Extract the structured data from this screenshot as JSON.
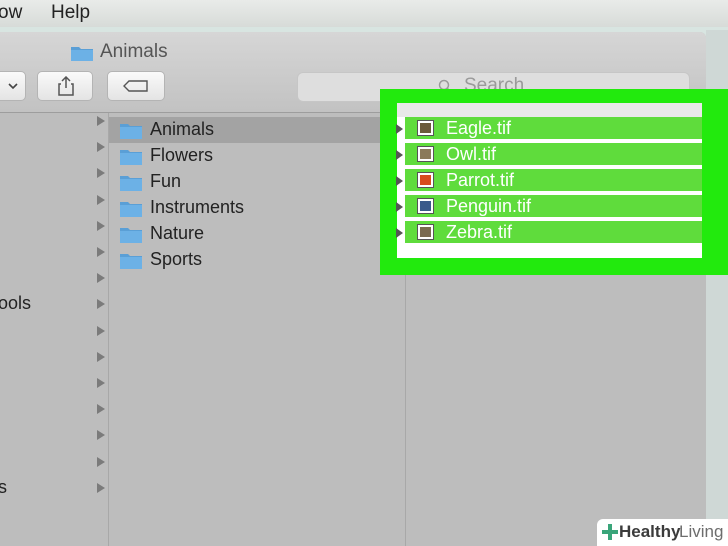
{
  "menu": {
    "item1": "ow",
    "item2": "Help"
  },
  "window": {
    "title": "Animals",
    "search_placeholder": "Search"
  },
  "sidebar": {
    "items": [
      {
        "label": ""
      },
      {
        "label": ""
      },
      {
        "label": ""
      },
      {
        "label": ""
      },
      {
        "label": ""
      },
      {
        "label": ""
      },
      {
        "label": ""
      },
      {
        "label": "ools"
      },
      {
        "label": ""
      },
      {
        "label": ""
      },
      {
        "label": ""
      },
      {
        "label": ""
      },
      {
        "label": ""
      },
      {
        "label": ""
      },
      {
        "label": "s"
      }
    ]
  },
  "folders": [
    {
      "label": "Animals",
      "selected": true
    },
    {
      "label": "Flowers",
      "selected": false
    },
    {
      "label": "Fun",
      "selected": false
    },
    {
      "label": "Instruments",
      "selected": false
    },
    {
      "label": "Nature",
      "selected": false
    },
    {
      "label": "Sports",
      "selected": false
    }
  ],
  "files": [
    {
      "label": "Eagle.tif",
      "thumb_color": "#6b5a3a"
    },
    {
      "label": "Owl.tif",
      "thumb_color": "#8a7a5a"
    },
    {
      "label": "Parrot.tif",
      "thumb_color": "#d84c1e"
    },
    {
      "label": "Penguin.tif",
      "thumb_color": "#3a5a8a"
    },
    {
      "label": "Zebra.tif",
      "thumb_color": "#7a6a50"
    }
  ],
  "watermark": {
    "bold": "Healthy",
    "light": "Living"
  },
  "colors": {
    "highlight": "#22ea0d",
    "folder": "#5a9fd6"
  }
}
